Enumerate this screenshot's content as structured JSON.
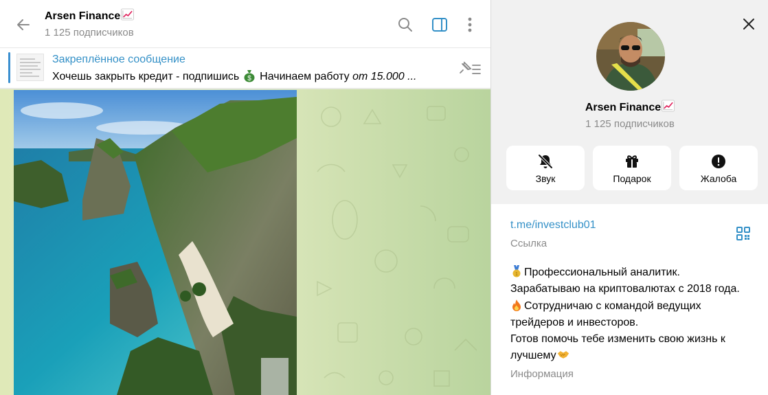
{
  "chat": {
    "title": "Arsen Finance",
    "subscribers": "1 125 подписчиков",
    "pinned": {
      "title": "Закреплённое сообщение",
      "text_before": "Хочешь закрыть кредит - подпишись",
      "text_after": "Начинаем работу",
      "text_italic": "от 15.000 ..."
    }
  },
  "profile": {
    "name": "Arsen Finance",
    "subscribers": "1 125 подписчиков",
    "actions": [
      {
        "label": "Звук",
        "icon": "bell-off-icon"
      },
      {
        "label": "Подарок",
        "icon": "gift-icon"
      },
      {
        "label": "Жалоба",
        "icon": "alert-circle-icon"
      }
    ],
    "link": "t.me/investclub01",
    "link_caption": "Ссылка",
    "bio": [
      "Профессиональный аналитик.",
      "Зарабатываю на криптовалютах с 2018 года.",
      "Сотрудничаю с командой ведущих",
      "трейдеров и инвесторов.",
      "Готов помочь тебе изменить свою жизнь к",
      "лучшему"
    ],
    "info_caption": "Информация"
  },
  "colors": {
    "accent": "#3390c7",
    "secondary_text": "#8a8a8a",
    "panel_bg": "#f1f1f1"
  }
}
